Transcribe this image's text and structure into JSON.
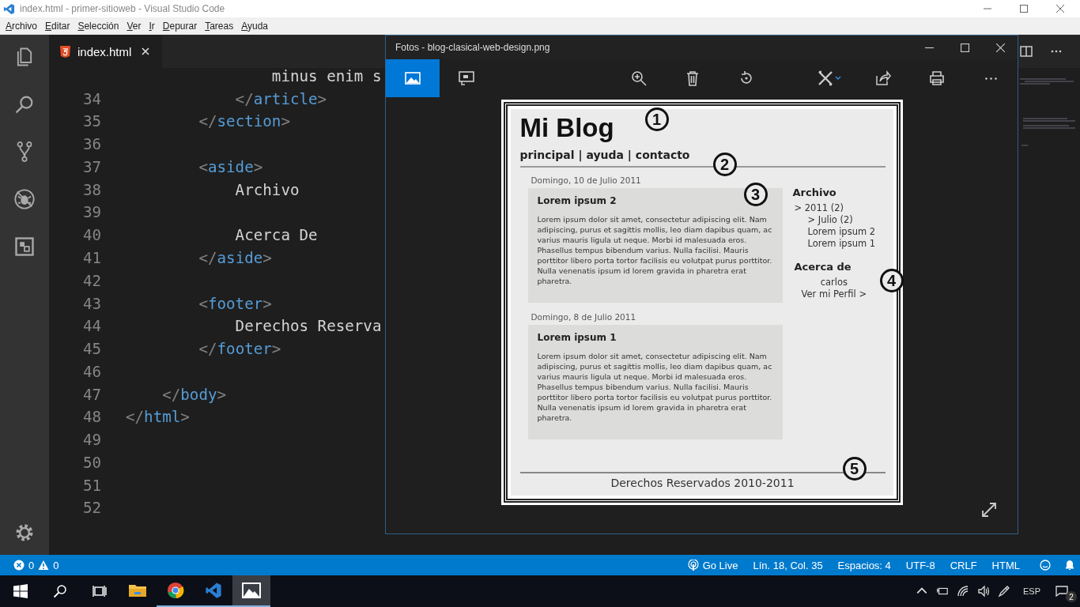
{
  "window": {
    "title": "index.html - primer-sitioweb - Visual Studio Code"
  },
  "menu": [
    "Archivo",
    "Editar",
    "Selección",
    "Ver",
    "Ir",
    "Depurar",
    "Tareas",
    "Ayuda"
  ],
  "tabs": [
    {
      "label": "index.html",
      "selected": true
    }
  ],
  "code_lines": [
    {
      "tokens": [
        {
          "kind": "text",
          "text": "                minus enim s"
        }
      ]
    },
    {
      "number": "34",
      "tokens": [
        {
          "kind": "punct",
          "text": "            </"
        },
        {
          "kind": "tag",
          "text": "article"
        },
        {
          "kind": "punct",
          "text": ">"
        }
      ]
    },
    {
      "number": "35",
      "tokens": [
        {
          "kind": "punct",
          "text": "        </"
        },
        {
          "kind": "tag",
          "text": "section"
        },
        {
          "kind": "punct",
          "text": ">"
        }
      ]
    },
    {
      "number": "36"
    },
    {
      "number": "37",
      "tokens": [
        {
          "kind": "punct",
          "text": "        <"
        },
        {
          "kind": "tag",
          "text": "aside"
        },
        {
          "kind": "punct",
          "text": ">"
        }
      ]
    },
    {
      "number": "38",
      "tokens": [
        {
          "kind": "text",
          "text": "            Archivo"
        }
      ]
    },
    {
      "number": "39"
    },
    {
      "number": "40",
      "tokens": [
        {
          "kind": "text",
          "text": "            Acerca De"
        }
      ]
    },
    {
      "number": "41",
      "tokens": [
        {
          "kind": "punct",
          "text": "        </"
        },
        {
          "kind": "tag",
          "text": "aside"
        },
        {
          "kind": "punct",
          "text": ">"
        }
      ]
    },
    {
      "number": "42"
    },
    {
      "number": "43",
      "tokens": [
        {
          "kind": "punct",
          "text": "        <"
        },
        {
          "kind": "tag",
          "text": "footer"
        },
        {
          "kind": "punct",
          "text": ">"
        }
      ]
    },
    {
      "number": "44",
      "tokens": [
        {
          "kind": "text",
          "text": "            Derechos Reserva"
        }
      ]
    },
    {
      "number": "45",
      "tokens": [
        {
          "kind": "punct",
          "text": "        </"
        },
        {
          "kind": "tag",
          "text": "footer"
        },
        {
          "kind": "punct",
          "text": ">"
        }
      ]
    },
    {
      "number": "46"
    },
    {
      "number": "47",
      "tokens": [
        {
          "kind": "punct",
          "text": "    </"
        },
        {
          "kind": "tag",
          "text": "body"
        },
        {
          "kind": "punct",
          "text": ">"
        }
      ]
    },
    {
      "number": "48",
      "tokens": [
        {
          "kind": "punct",
          "text": "</"
        },
        {
          "kind": "tag",
          "text": "html"
        },
        {
          "kind": "punct",
          "text": ">"
        }
      ]
    },
    {
      "number": "49"
    },
    {
      "number": "50"
    },
    {
      "number": "51"
    },
    {
      "number": "52"
    }
  ],
  "photos": {
    "title": "Fotos - blog-clasical-web-design.png",
    "tools": [
      {
        "kind": "picture",
        "selected": true
      },
      {
        "kind": "slideshow",
        "selected": false
      },
      {
        "kind": "zoom"
      },
      {
        "kind": "delete"
      },
      {
        "kind": "rotate"
      },
      {
        "kind": "edit"
      },
      {
        "kind": "share"
      },
      {
        "kind": "print"
      },
      {
        "kind": "more"
      }
    ]
  },
  "blog": {
    "title": "Mi Blog",
    "nav": "principal | ayuda | contacto",
    "posts": [
      {
        "date": "Domingo, 10 de Julio 2011",
        "title": "Lorem ipsum 2",
        "body": "Lorem ipsum dolor sit amet, consectetur adipiscing elit. Nam adipiscing, purus et sagittis mollis, leo diam dapibus quam, ac varius mauris ligula ut neque. Morbi id malesuada eros. Phasellus tempus bibendum varius. Nulla facilisi. Mauris porttitor libero porta tortor facilisis eu volutpat purus porttitor. Nulla venenatis ipsum id lorem gravida in pharetra erat pharetra."
      },
      {
        "date": "Domingo, 8 de Julio 2011",
        "title": "Lorem ipsum 1",
        "body": "Lorem ipsum dolor sit amet, consectetur adipiscing elit. Nam adipiscing, purus et sagittis mollis, leo diam dapibus quam, ac varius mauris ligula ut neque. Morbi id malesuada eros. Phasellus tempus bibendum varius. Nulla facilisi. Mauris porttitor libero porta tortor facilisis eu volutpat purus porttitor. Nulla venenatis ipsum id lorem gravida in pharetra erat pharetra."
      }
    ],
    "archive_title": "Archivo",
    "archive": [
      {
        "label": "> 2011 (2)",
        "children": [
          {
            "label": "> Julio (2)"
          },
          {
            "label": "Lorem ipsum 2"
          },
          {
            "label": "Lorem ipsum 1"
          }
        ]
      }
    ],
    "about_title": "Acerca de",
    "author": "carlos",
    "profile_link": "Ver mi Perfil >",
    "footer": "Derechos Reservados 2010-2011",
    "callouts": [
      "1",
      "2",
      "3",
      "4",
      "5"
    ]
  },
  "status_bar": {
    "errors": "0",
    "warnings": "0",
    "items": [
      {
        "kind": "live",
        "label": "Go Live"
      },
      {
        "label": "Lín. 18, Col. 35"
      },
      {
        "label": "Espacios: 4"
      },
      {
        "label": "UTF-8"
      },
      {
        "label": "CRLF"
      },
      {
        "label": "HTML"
      }
    ]
  },
  "taskbar": {
    "apps": [
      {
        "kind": "explorer",
        "running": false,
        "selected": false
      },
      {
        "kind": "chrome",
        "running": true,
        "selected": false
      },
      {
        "kind": "vscode",
        "running": true,
        "selected": false
      },
      {
        "kind": "photos",
        "running": true,
        "selected": true
      }
    ],
    "language": "ESP",
    "notifications": "2"
  }
}
